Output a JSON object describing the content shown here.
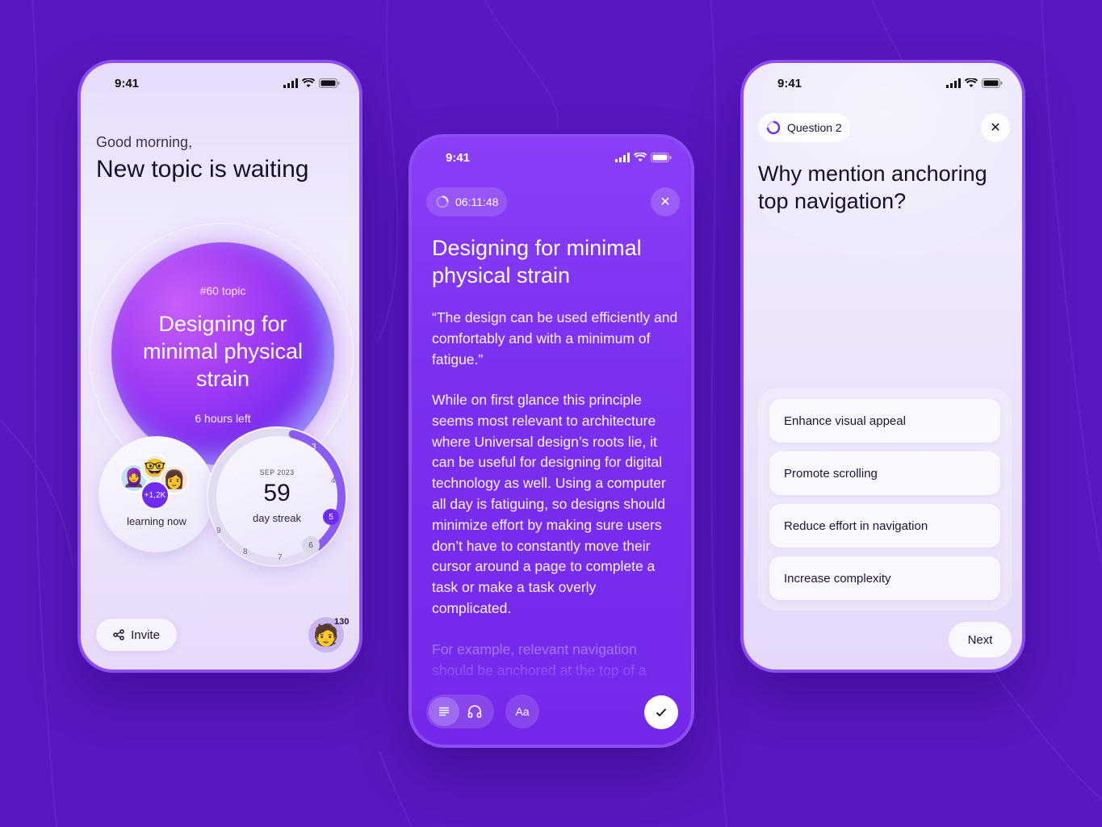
{
  "colors": {
    "background": "#5a16c0",
    "accent": "#6f2bf0",
    "article_screen": "#7b30f0",
    "light_screen": "#efe9fb"
  },
  "status_bar": {
    "time": "9:41",
    "icons": [
      "cellular-icon",
      "wifi-icon",
      "battery-icon"
    ]
  },
  "home": {
    "greeting": "Good morning,",
    "headline": "New topic is waiting",
    "topic": {
      "tag": "#60 topic",
      "title": "Designing for minimal physical strain",
      "time_left": "6 hours left"
    },
    "learning": {
      "count": "+1,2K",
      "label": "learning now",
      "avatars": [
        "hijab-avatar",
        "glasses-avatar",
        "beret-avatar"
      ]
    },
    "streak": {
      "date": "SEP 2023",
      "number": "59",
      "label": "day streak",
      "days": [
        "3",
        "4",
        "5",
        "6",
        "7",
        "8",
        "9"
      ],
      "active_day": "5",
      "progress_fraction": 0.35
    },
    "invite_label": "Invite",
    "profile_points": "130"
  },
  "article": {
    "timer": "06:11:48",
    "title": "Designing for minimal physical strain",
    "quote": "“The design can be used efficiently and comfortably and with a minimum of fatigue.”",
    "body": "While on first glance this principle seems most relevant to architecture where Universal design’s roots lie, it can be useful for designing for digital technology as well. Using a computer all day is fatiguing, so designs should minimize effort by making sure users don’t have to constantly move their cursor around a page to complete a task or make a task overly complicated.",
    "faded": "For example, relevant navigation should be anchored at the top of a webpage, so the user doesn’t have to",
    "font_button": "Aa"
  },
  "quiz": {
    "question_label": "Question 2",
    "question": "Why mention anchoring top navigation?",
    "answers": [
      "Enhance visual appeal",
      "Promote scrolling",
      "Reduce effort in navigation",
      "Increase complexity"
    ],
    "next_label": "Next"
  }
}
